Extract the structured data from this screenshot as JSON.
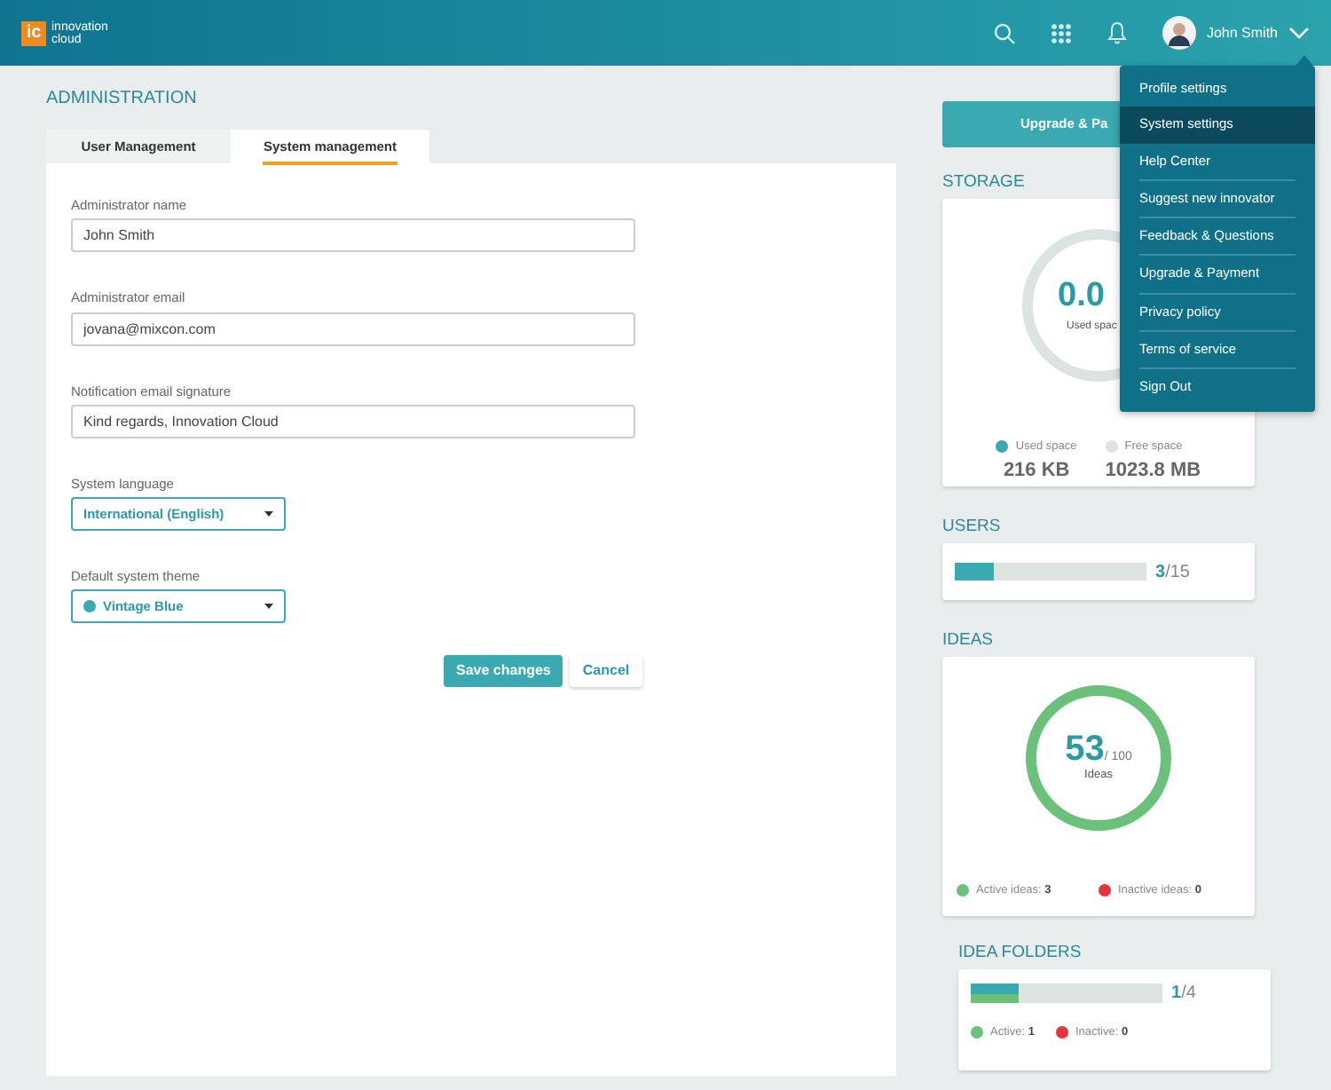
{
  "header": {
    "logo_mark": "ic",
    "logo_text_1": "innovation",
    "logo_text_2": "cloud",
    "user_name": "John Smith"
  },
  "user_menu": [
    {
      "label": "Profile settings",
      "selected": false
    },
    {
      "label": "System settings",
      "selected": true
    },
    {
      "label": "Help Center",
      "selected": false
    },
    {
      "label": "Suggest new innovator",
      "selected": false
    },
    {
      "label": "Feedback & Questions",
      "selected": false
    },
    {
      "label": "Upgrade & Payment",
      "selected": false
    },
    {
      "label": "Privacy policy",
      "selected": false
    },
    {
      "label": "Terms of service",
      "selected": false
    },
    {
      "label": "Sign Out",
      "selected": false
    }
  ],
  "page_title": "ADMINISTRATION",
  "tabs": [
    {
      "label": "User Management",
      "selected": false
    },
    {
      "label": "System management",
      "selected": true
    }
  ],
  "form": [
    {
      "kind": "text",
      "label": "Administrator name",
      "value": "John Smith"
    },
    {
      "kind": "text",
      "label": "Administrator email",
      "value": "jovana@mixcon.com"
    },
    {
      "kind": "text",
      "label": "Notification email signature",
      "value": "Kind regards, Innovation Cloud"
    },
    {
      "kind": "select",
      "label": "System language",
      "value": "International (English)"
    },
    {
      "kind": "select",
      "label": "Default system theme",
      "value": "Vintage Blue",
      "color": "#3aa9b1"
    }
  ],
  "buttons": [
    {
      "label": "Save changes",
      "kind": "primary"
    },
    {
      "label": "Cancel",
      "kind": "secondary"
    }
  ],
  "upgrade_button": "Upgrade & Pa",
  "storage": {
    "title": "STORAGE",
    "value": "0.0",
    "caption": "Used spac",
    "level": 0,
    "legend": [
      {
        "label": "Used space",
        "value": "216 KB",
        "color": "#3aa9b1"
      },
      {
        "label": "Free space",
        "value": "1023.8 MB",
        "color": "#dde3e1"
      }
    ]
  },
  "users": {
    "title": "USERS",
    "level": 0.2,
    "count": "3",
    "total": "/15"
  },
  "ideas": {
    "title": "IDEAS",
    "count": "53",
    "total": "/ 100",
    "caption": "Ideas",
    "legend": [
      {
        "label": "Active ideas:",
        "value": "3",
        "color": "#6cc17a"
      },
      {
        "label": "Inactive ideas:",
        "value": "0",
        "color": "#e8333c"
      }
    ]
  },
  "idea_folders": {
    "title": "IDEA FOLDERS",
    "level": 0.25,
    "count": "1",
    "total": "/4",
    "legend": [
      {
        "label": "Active:",
        "value": "1",
        "color": "#6cc17a"
      },
      {
        "label": "Inactive:",
        "value": "0",
        "color": "#e8333c"
      }
    ]
  }
}
